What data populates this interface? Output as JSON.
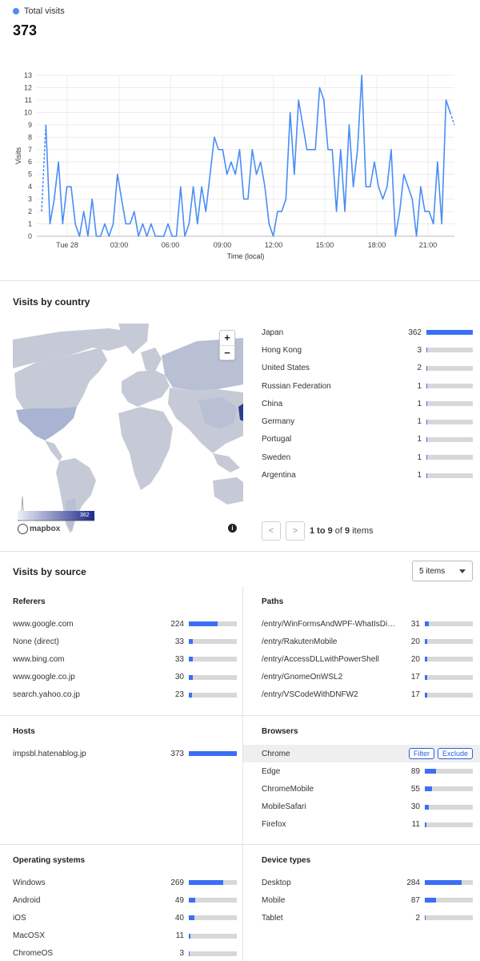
{
  "header": {
    "legend_label": "Total visits",
    "total": "373"
  },
  "chart_data": {
    "type": "line",
    "xlabel": "Time (local)",
    "ylabel": "Visits",
    "ylim": [
      0,
      13
    ],
    "yticks": [
      0,
      1,
      2,
      3,
      4,
      5,
      6,
      7,
      8,
      9,
      10,
      11,
      12,
      13
    ],
    "xtick_labels": [
      "Tue 28",
      "03:00",
      "06:00",
      "09:00",
      "12:00",
      "15:00",
      "18:00",
      "21:00"
    ],
    "series": [
      {
        "color": "#4a8df6",
        "values": [
          2,
          9,
          1,
          3,
          6,
          1,
          4,
          4,
          1,
          0,
          2,
          0,
          3,
          0,
          0,
          1,
          0,
          1,
          5,
          3,
          1,
          1,
          2,
          0,
          1,
          0,
          1,
          0,
          0,
          0,
          1,
          0,
          0,
          4,
          0,
          1,
          4,
          1,
          4,
          2,
          5,
          8,
          7,
          7,
          5,
          6,
          5,
          7,
          3,
          3,
          7,
          5,
          6,
          4,
          1,
          0,
          2,
          2,
          3,
          10,
          5,
          11,
          9,
          7,
          7,
          7,
          12,
          11,
          7,
          7,
          2,
          7,
          2,
          9,
          4,
          7,
          13,
          4,
          4,
          6,
          4,
          3,
          4,
          7,
          0,
          2,
          5,
          4,
          3,
          0,
          4,
          2,
          2,
          1,
          6,
          1,
          11,
          10,
          9
        ]
      }
    ]
  },
  "country_section": {
    "title": "Visits by country",
    "zoom_in": "+",
    "zoom_out": "−",
    "legend_max": "362",
    "mapbox": "mapbox",
    "info": "i",
    "countries": [
      {
        "name": "Japan",
        "count": "362",
        "frac": 1.0
      },
      {
        "name": "Hong Kong",
        "count": "3",
        "frac": 0.02
      },
      {
        "name": "United States",
        "count": "2",
        "frac": 0.015
      },
      {
        "name": "Russian Federation",
        "count": "1",
        "frac": 0.01
      },
      {
        "name": "China",
        "count": "1",
        "frac": 0.01
      },
      {
        "name": "Germany",
        "count": "1",
        "frac": 0.01
      },
      {
        "name": "Portugal",
        "count": "1",
        "frac": 0.01
      },
      {
        "name": "Sweden",
        "count": "1",
        "frac": 0.01
      },
      {
        "name": "Argentina",
        "count": "1",
        "frac": 0.01
      }
    ],
    "pager": {
      "prev": "<",
      "next": ">",
      "range": "1 to 9",
      "of": "of",
      "total": "9",
      "suffix": "items"
    }
  },
  "source_section": {
    "title": "Visits by source",
    "items_select": "5 items",
    "referers": {
      "title": "Referers",
      "rows": [
        {
          "label": "www.google.com",
          "count": "224",
          "frac": 0.6
        },
        {
          "label": "None (direct)",
          "count": "33",
          "frac": 0.09
        },
        {
          "label": "www.bing.com",
          "count": "33",
          "frac": 0.09
        },
        {
          "label": "www.google.co.jp",
          "count": "30",
          "frac": 0.08
        },
        {
          "label": "search.yahoo.co.jp",
          "count": "23",
          "frac": 0.06
        }
      ]
    },
    "paths": {
      "title": "Paths",
      "rows": [
        {
          "label": "/entry/WinFormsAndWPF-WhatIsDif...",
          "count": "31",
          "frac": 0.08
        },
        {
          "label": "/entry/RakutenMobile",
          "count": "20",
          "frac": 0.05
        },
        {
          "label": "/entry/AccessDLLwithPowerShell",
          "count": "20",
          "frac": 0.05
        },
        {
          "label": "/entry/GnomeOnWSL2",
          "count": "17",
          "frac": 0.045
        },
        {
          "label": "/entry/VSCodeWithDNFW2",
          "count": "17",
          "frac": 0.045
        }
      ]
    },
    "hosts": {
      "title": "Hosts",
      "rows": [
        {
          "label": "impsbl.hatenablog.jp",
          "count": "373",
          "frac": 1.0
        }
      ]
    },
    "browsers": {
      "title": "Browsers",
      "filter_label": "Filter",
      "exclude_label": "Exclude",
      "rows": [
        {
          "label": "Chrome",
          "count": "",
          "frac": 0
        },
        {
          "label": "Edge",
          "count": "89",
          "frac": 0.24
        },
        {
          "label": "ChromeMobile",
          "count": "55",
          "frac": 0.15
        },
        {
          "label": "MobileSafari",
          "count": "30",
          "frac": 0.08
        },
        {
          "label": "Firefox",
          "count": "11",
          "frac": 0.03
        }
      ]
    },
    "os": {
      "title": "Operating systems",
      "rows": [
        {
          "label": "Windows",
          "count": "269",
          "frac": 0.72
        },
        {
          "label": "Android",
          "count": "49",
          "frac": 0.13
        },
        {
          "label": "iOS",
          "count": "40",
          "frac": 0.11
        },
        {
          "label": "MacOSX",
          "count": "11",
          "frac": 0.03
        },
        {
          "label": "ChromeOS",
          "count": "3",
          "frac": 0.01
        }
      ]
    },
    "devices": {
      "title": "Device types",
      "rows": [
        {
          "label": "Desktop",
          "count": "284",
          "frac": 0.76
        },
        {
          "label": "Mobile",
          "count": "87",
          "frac": 0.23
        },
        {
          "label": "Tablet",
          "count": "2",
          "frac": 0.01
        }
      ]
    }
  },
  "colors": {
    "accent": "#3a6ff5",
    "line": "#4a8df6",
    "track": "#d8d8d8"
  }
}
